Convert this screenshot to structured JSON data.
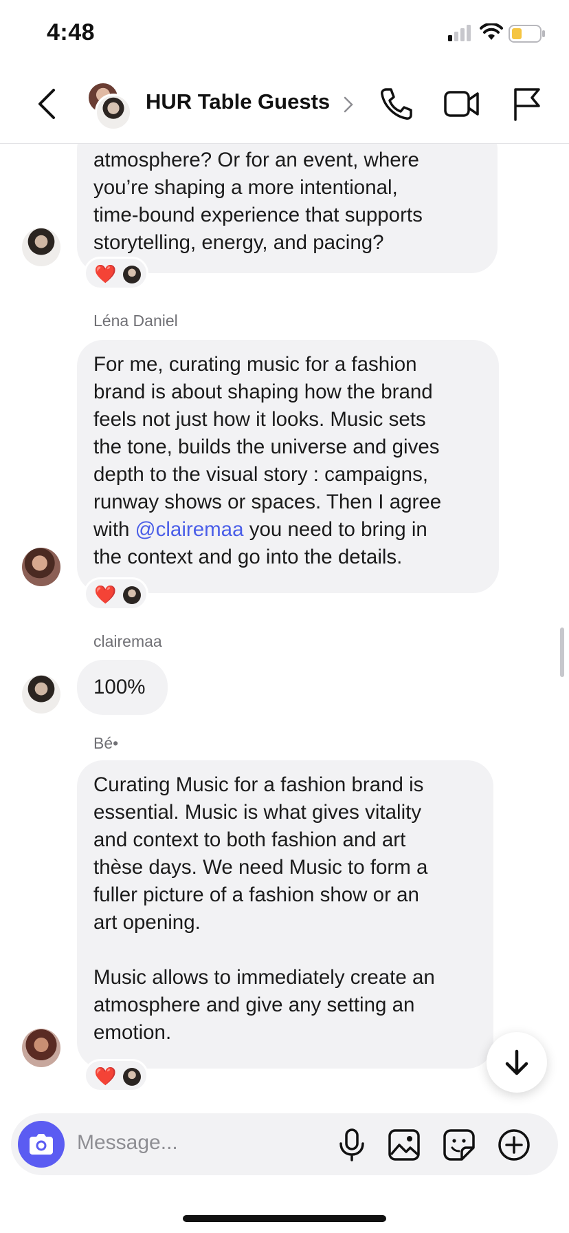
{
  "status": {
    "time": "4:48"
  },
  "header": {
    "title": "HUR Table Guests"
  },
  "messages": [
    {
      "sender": "",
      "text": "atmosphere? Or for an event, where\nyou’re shaping a more intentional,\ntime-bound experience that supports\nstorytelling, energy, and pacing?"
    },
    {
      "sender": "Léna Daniel",
      "text_a": "For me, curating music for a fashion\nbrand is about shaping how the brand\nfeels not just how it looks. Music sets\nthe tone, builds the universe and gives\ndepth to the visual story : campaigns,\nrunway shows or spaces. Then I agree\nwith ",
      "mention": "@clairemaa",
      "text_b": " you need to bring in\nthe context and go into the details."
    },
    {
      "sender": "clairemaa",
      "text": "100%"
    },
    {
      "sender": "Bé•",
      "text": "Curating Music for a fashion brand is\nessential. Music is what gives vitality\nand context to both fashion and art\nthèse days. We need Music to form a\nfuller picture of a fashion show or an\nart opening.\n\nMusic allows to immediately create an\natmosphere and give any setting an\nemotion."
    }
  ],
  "reaction_emoji": "❤️",
  "composer": {
    "placeholder": "Message..."
  },
  "colors": {
    "accent": "#5b5cf2",
    "bubble": "#f2f2f4",
    "mention": "#4a5ee8",
    "heart": "#e0222f"
  },
  "icons": [
    "back-icon",
    "phone-icon",
    "video-icon",
    "flag-icon",
    "arrow-down-icon",
    "camera-icon",
    "microphone-icon",
    "gallery-icon",
    "sticker-icon",
    "plus-icon"
  ]
}
